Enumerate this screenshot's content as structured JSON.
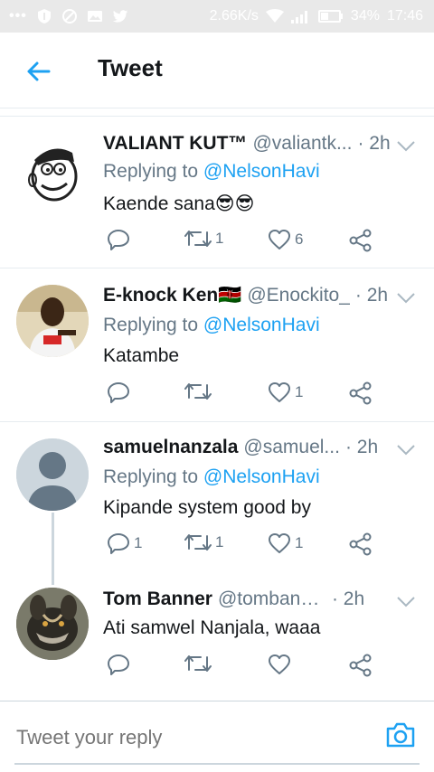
{
  "status_bar": {
    "dots": "•••",
    "speed": "2.66K/s",
    "battery": "34%",
    "time": "17:46"
  },
  "header": {
    "title": "Tweet",
    "back_icon": "arrow-left-icon",
    "accent_color": "#1da1f2"
  },
  "tweets": [
    {
      "name": "VALIANT KUT™",
      "handle": "@valiantk...",
      "time": "· 2h",
      "replying_label": "Replying to ",
      "replying_to": "@NelsonHavi",
      "text": "Kaende sana😎😎",
      "reply_count": "",
      "retweet_count": "1",
      "like_count": "6"
    },
    {
      "name": "E-knock Ken🇰🇪",
      "handle": "@Enockito_",
      "time": "· 2h",
      "replying_label": "Replying to ",
      "replying_to": "@NelsonHavi",
      "text": "Katambe",
      "reply_count": "",
      "retweet_count": "",
      "like_count": "1"
    },
    {
      "name": "samuelnanzala",
      "handle": "@samuel...",
      "time": "· 2h",
      "replying_label": "Replying to ",
      "replying_to": "@NelsonHavi",
      "text": "Kipande system good by",
      "reply_count": "1",
      "retweet_count": "1",
      "like_count": "1"
    },
    {
      "name": "Tom Banner",
      "handle": "@tombanner...",
      "time": "· 2h",
      "text": "Ati samwel Nanjala, waaa",
      "reply_count": "",
      "retweet_count": "",
      "like_count": ""
    }
  ],
  "reply_bar": {
    "placeholder": "Tweet your reply",
    "camera_icon": "camera-icon"
  }
}
